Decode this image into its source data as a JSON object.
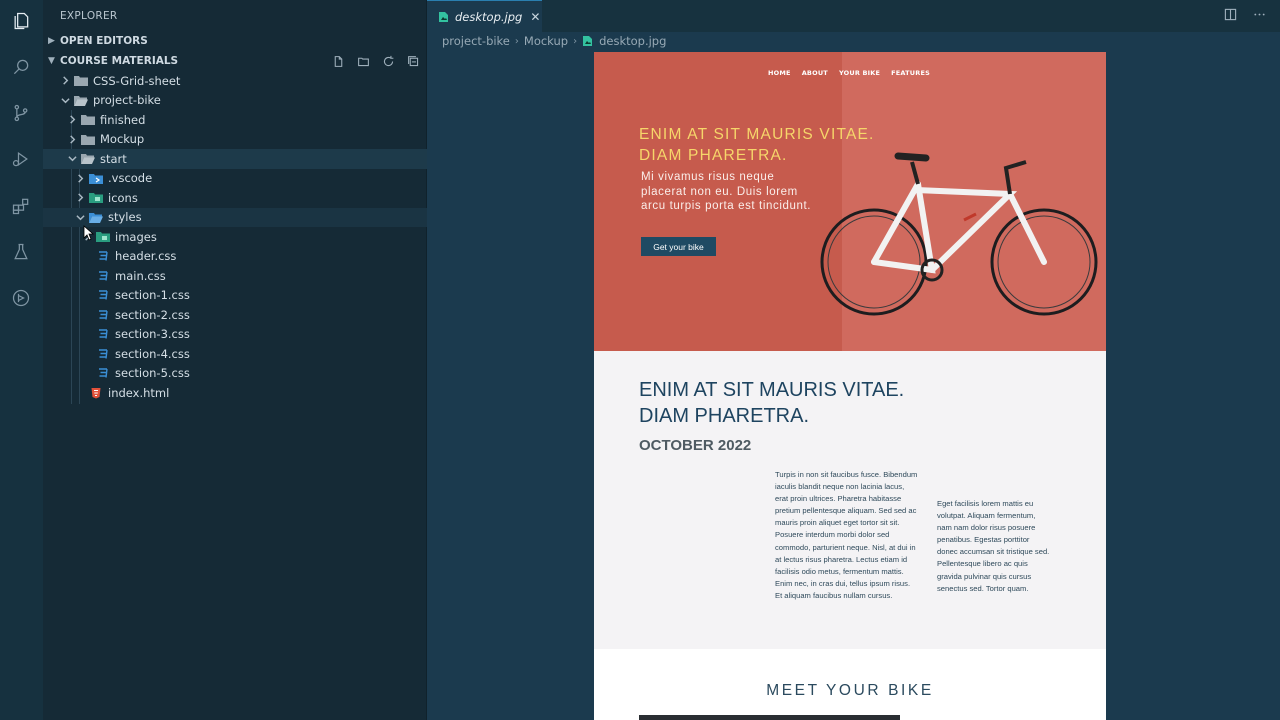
{
  "colors": {
    "editor_bg": "#1b3a4e",
    "sidebar_bg": "#152a36",
    "activity_bg": "#16313f",
    "hero_red": "#c65b4d",
    "hero_title": "#f6d66a",
    "hero_button": "#1f4a63",
    "css_icon": "#3b8fd6",
    "html_icon": "#e2513a",
    "image_icon": "#33c2a0"
  },
  "activity_bar": {
    "icons": [
      "files-icon",
      "search-icon",
      "source-control-icon",
      "run-debug-icon",
      "extensions-icon",
      "testing-icon",
      "remote-explorer-icon"
    ]
  },
  "explorer": {
    "title": "EXPLORER",
    "open_editors": "OPEN EDITORS",
    "course_materials": "COURSE MATERIALS",
    "tools": [
      "new-file-icon",
      "new-folder-icon",
      "refresh-icon",
      "collapse-all-icon"
    ],
    "tree": [
      {
        "label": "CSS-Grid-sheet",
        "type": "folder",
        "expanded": false
      },
      {
        "label": "project-bike",
        "type": "folder",
        "expanded": true
      },
      {
        "label": "finished",
        "type": "folder",
        "expanded": false
      },
      {
        "label": "Mockup",
        "type": "folder",
        "expanded": false
      },
      {
        "label": "start",
        "type": "folder",
        "expanded": true
      },
      {
        "label": ".vscode",
        "type": "folder-vscode",
        "expanded": false
      },
      {
        "label": "icons",
        "type": "folder-images",
        "expanded": false
      },
      {
        "label": "styles",
        "type": "folder-styles",
        "expanded": true
      },
      {
        "label": "images",
        "type": "folder-images",
        "expanded": false
      },
      {
        "label": "header.css",
        "type": "css"
      },
      {
        "label": "main.css",
        "type": "css"
      },
      {
        "label": "section-1.css",
        "type": "css"
      },
      {
        "label": "section-2.css",
        "type": "css"
      },
      {
        "label": "section-3.css",
        "type": "css"
      },
      {
        "label": "section-4.css",
        "type": "css"
      },
      {
        "label": "section-5.css",
        "type": "css"
      },
      {
        "label": "index.html",
        "type": "html"
      }
    ]
  },
  "editor": {
    "tab_label": "desktop.jpg",
    "tab_close": "✕",
    "breadcrumb": [
      "project-bike",
      "Mockup",
      "desktop.jpg"
    ],
    "actions": [
      "split-editor-icon",
      "more-actions-icon"
    ]
  },
  "mockup": {
    "nav": [
      "HOME",
      "ABOUT",
      "YOUR BIKE",
      "FEATURES"
    ],
    "hero_title": "ENIM AT SIT MAURIS VITAE. DIAM PHARETRA.",
    "hero_subtitle": "Mi vivamus risus neque placerat non eu. Duis lorem arcu turpis porta est tincidunt.",
    "hero_button": "Get your bike",
    "section_title": "ENIM AT SIT MAURIS VITAE. DIAM PHARETRA.",
    "section_date": "OCTOBER 2022",
    "col1_text": "Turpis in non sit faucibus fusce. Bibendum iaculis blandit neque non lacinia lacus, erat proin ultrices. Pharetra habitasse pretium pellentesque aliquam. Sed sed ac mauris proin aliquet eget tortor sit sit. Posuere interdum morbi dolor sed commodo, parturient neque. Nisl, at dui in at lectus risus pharetra. Lectus etiam id facilisis odio metus, fermentum mattis.",
    "col1_text2": "Enim nec, in cras dui, tellus ipsum risus. Et aliquam faucibus nullam cursus.",
    "col2_text": "Eget facilisis lorem mattis eu volutpat. Aliquam fermentum, nam nam dolor risus posuere penatibus. Egestas porttitor donec accumsan sit tristique sed. Pellentesque libero ac quis gravida pulvinar quis cursus senectus sed. Tortor quam.",
    "section2_title": "MEET YOUR BIKE"
  }
}
